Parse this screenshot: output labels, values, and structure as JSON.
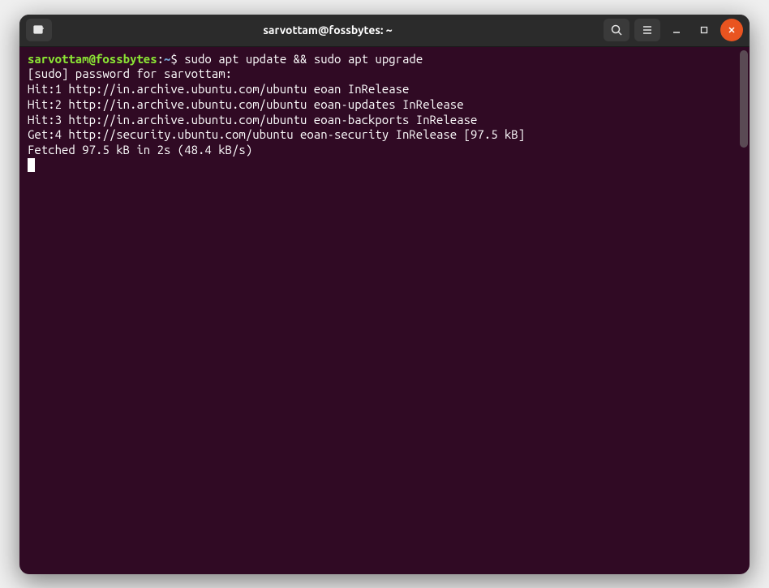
{
  "window": {
    "title": "sarvottam@fossbytes: ~"
  },
  "prompt": {
    "user_host": "sarvottam@fossbytes",
    "separator": ":",
    "path": "~",
    "symbol": "$"
  },
  "command": "sudo apt update && sudo apt upgrade",
  "output": {
    "lines": [
      "[sudo] password for sarvottam:",
      "Hit:1 http://in.archive.ubuntu.com/ubuntu eoan InRelease",
      "Hit:2 http://in.archive.ubuntu.com/ubuntu eoan-updates InRelease",
      "Hit:3 http://in.archive.ubuntu.com/ubuntu eoan-backports InRelease",
      "Get:4 http://security.ubuntu.com/ubuntu eoan-security InRelease [97.5 kB]",
      "Fetched 97.5 kB in 2s (48.4 kB/s)"
    ]
  },
  "icons": {
    "new_tab": "new-tab-icon",
    "search": "search-icon",
    "menu": "hamburger-menu-icon",
    "minimize": "minimize-icon",
    "maximize": "maximize-icon",
    "close": "close-icon"
  }
}
